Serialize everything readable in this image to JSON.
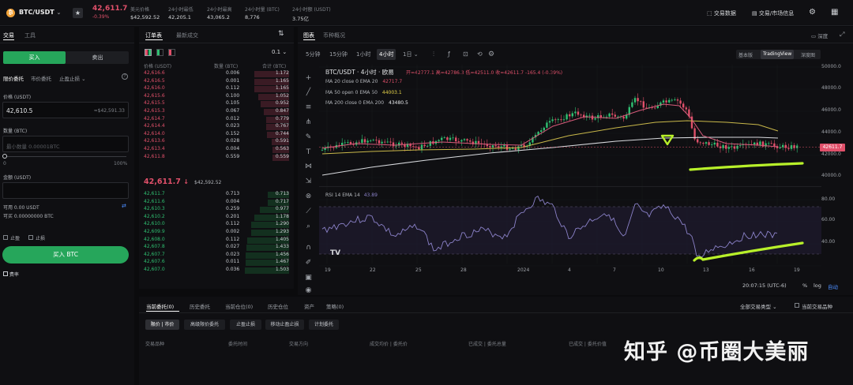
{
  "header": {
    "pair": "BTC/USDT",
    "price": "42,611.7",
    "change": "-0.39%",
    "stats": [
      {
        "label": "美元价格",
        "value": "$42,592.52"
      },
      {
        "label": "24小时最低",
        "value": "42,205.1"
      },
      {
        "label": "24小时最高",
        "value": "43,065.2"
      },
      {
        "label": "24小时量 (BTC)",
        "value": "8,776"
      },
      {
        "label": "24小时额 (USDT)",
        "value": "3.75亿"
      }
    ],
    "right_links": [
      "交易数据",
      "交易/市场信息"
    ]
  },
  "trade": {
    "tabs": [
      "交易",
      "工具"
    ],
    "buy": "买入",
    "sell": "卖出",
    "order_types": [
      "限价委托",
      "市价委托",
      "止盈止损"
    ],
    "price_label": "价格 (USDT)",
    "price_value": "42,610.5",
    "price_usd": "≈$42,591.33",
    "qty_label": "数量 (BTC)",
    "qty_placeholder": "最小数量 0.00001BTC",
    "slider_min": "0",
    "slider_max": "100%",
    "amount_label": "金额 (USDT)",
    "avail_usdt": "可用 0.00 USDT",
    "avail_btc": "可买 0.00000000 BTC",
    "tp": "止盈",
    "sl": "止损",
    "submit": "买入 BTC",
    "footer": "费率"
  },
  "orderbook": {
    "tabs": [
      "订单表",
      "最新成交"
    ],
    "precision": "0.1",
    "headers": [
      "价格 (USDT)",
      "数量 (BTC)",
      "合计 (BTC)"
    ],
    "asks": [
      [
        "42,616.6",
        "0.006",
        "1.172"
      ],
      [
        "42,616.5",
        "0.001",
        "1.165"
      ],
      [
        "42,616.0",
        "0.112",
        "1.165"
      ],
      [
        "42,615.6",
        "0.100",
        "1.052"
      ],
      [
        "42,615.5",
        "0.105",
        "0.952"
      ],
      [
        "42,615.3",
        "0.067",
        "0.847"
      ],
      [
        "42,614.7",
        "0.012",
        "0.779"
      ],
      [
        "42,614.4",
        "0.023",
        "0.767"
      ],
      [
        "42,614.0",
        "0.152",
        "0.744"
      ],
      [
        "42,613.6",
        "0.028",
        "0.591"
      ],
      [
        "42,613.4",
        "0.004",
        "0.563"
      ],
      [
        "42,611.8",
        "0.559",
        "0.559"
      ]
    ],
    "mid_price": "42,611.7",
    "mid_arrow": "↓",
    "mid_usd": "$42,592.52",
    "bids": [
      [
        "42,611.7",
        "0.713",
        "0.713"
      ],
      [
        "42,611.6",
        "0.004",
        "0.717"
      ],
      [
        "42,610.3",
        "0.259",
        "0.977"
      ],
      [
        "42,610.2",
        "0.201",
        "1.178"
      ],
      [
        "42,610.0",
        "0.112",
        "1.290"
      ],
      [
        "42,609.9",
        "0.002",
        "1.293"
      ],
      [
        "42,608.0",
        "0.112",
        "1.405"
      ],
      [
        "42,607.8",
        "0.027",
        "1.433"
      ],
      [
        "42,607.7",
        "0.023",
        "1.456"
      ],
      [
        "42,607.6",
        "0.011",
        "1.467"
      ],
      [
        "42,607.0",
        "0.036",
        "1.503"
      ]
    ]
  },
  "chart": {
    "tabs": [
      "图表",
      "币种概况"
    ],
    "top_right": "深度",
    "timeframes": [
      "5分钟",
      "15分钟",
      "1小时",
      "4小时",
      "1日"
    ],
    "active_timeframe": "4小时",
    "views": [
      "基本版",
      "TradingView",
      "深度图"
    ],
    "legend_title": "BTC/USDT · 4小时 · 欧易",
    "ohlc": "开=42777.1  高=42786.3  低=42511.0  收=42611.7  -165.4 (-0.39%)",
    "ma20": "MA 20 close 0 EMA 20",
    "ma20_val": "42717.7",
    "ma50": "MA 50 open 0 EMA 50",
    "ma50_val": "44003.1",
    "ma200": "MA 200 close 0 EMA 200",
    "ma200_val": "43480.5",
    "rsi_label": "RSI 14 EMA 14",
    "rsi_val": "43.89",
    "price_ticks": [
      "50000.0",
      "48000.0",
      "46000.0",
      "44000.0",
      "42000.0",
      "40000.0"
    ],
    "current_price_tag": "42611.7",
    "rsi_ticks": [
      "80.00",
      "60.00",
      "40.00"
    ],
    "date_ticks": [
      "19",
      "22",
      "25",
      "28",
      "2024",
      "4",
      "7",
      "10",
      "13",
      "16",
      "19"
    ],
    "time_label": "20:07:15 (UTC-6)",
    "percent": "%",
    "log": "log",
    "auto": "自动"
  },
  "bottom": {
    "tabs": [
      "当前委托(0)",
      "历史委托",
      "当前仓位(0)",
      "历史仓位",
      "资产",
      "策略(0)"
    ],
    "filter": "全部交易类型",
    "show_all": "当前交易品种",
    "subtabs": [
      "限价 | 市价",
      "高级限价委托",
      "止盈止损",
      "移动止盈止损",
      "计划委托"
    ],
    "headers": [
      "交易品种",
      "委托时间",
      "交易方向",
      "成交均价 | 委托价",
      "已成交 | 委托总量",
      "已成交 | 委托价值"
    ]
  },
  "watermark": "知乎 @币圈大美丽",
  "colors": {
    "up": "#2fbf71",
    "down": "#e0506a",
    "accent": "#b8f02a"
  }
}
